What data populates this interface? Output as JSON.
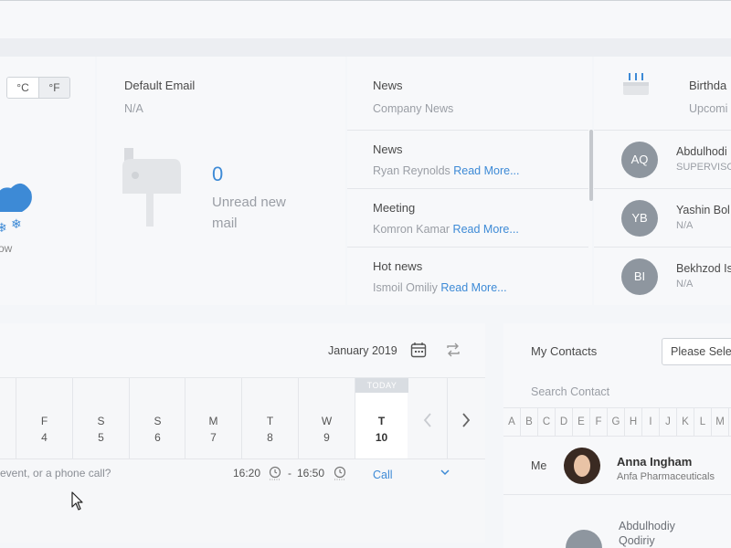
{
  "weather": {
    "units": [
      "°C",
      "°F"
    ],
    "active_unit": "°F",
    "condition": "ow"
  },
  "email": {
    "title": "Default Email",
    "address": "N/A",
    "unread_count": "0",
    "unread_label": "Unread new mail"
  },
  "news": {
    "title": "News",
    "subtitle": "Company News",
    "read_more": "Read More...",
    "items": [
      {
        "title": "News",
        "author": "Ryan Reynolds"
      },
      {
        "title": "Meeting",
        "author": "Komron Kamar"
      },
      {
        "title": "Hot news",
        "author": "Ismoil Omiliy"
      }
    ]
  },
  "birthdays": {
    "title": "Birthda",
    "subtitle": "Upcomi",
    "items": [
      {
        "initials": "AQ",
        "name": "Abdulhodi",
        "role": "SUPERVISO"
      },
      {
        "initials": "YB",
        "name": "Yashin Bol",
        "role": "N/A"
      },
      {
        "initials": "BI",
        "name": "Bekhzod Is",
        "role": "N/A"
      }
    ]
  },
  "calendar": {
    "month": "January 2019",
    "today_tag": "TODAY",
    "days": [
      {
        "name": "F",
        "date": "4"
      },
      {
        "name": "S",
        "date": "5"
      },
      {
        "name": "S",
        "date": "6"
      },
      {
        "name": "M",
        "date": "7"
      },
      {
        "name": "T",
        "date": "8"
      },
      {
        "name": "W",
        "date": "9"
      },
      {
        "name": "T",
        "date": "10"
      }
    ],
    "event_placeholder": "event, or a phone call?",
    "time_start": "16:20",
    "time_sep": "-",
    "time_end": "16:50",
    "event_type": "Call"
  },
  "contacts": {
    "title": "My Contacts",
    "select_value": "Please Sele",
    "search_placeholder": "Search Contact",
    "letters": [
      "A",
      "B",
      "C",
      "D",
      "E",
      "F",
      "G",
      "H",
      "I",
      "J",
      "K",
      "L",
      "M"
    ],
    "me_label": "Me",
    "me_name": "Anna Ingham",
    "me_company": "Anfa Pharmaceuticals",
    "second_name": "Abdulhodiy Qodiriy"
  },
  "colors": {
    "accent": "#3d8ad6",
    "avatar_bg": "#8e969f",
    "snow": "#3d8ad6"
  }
}
